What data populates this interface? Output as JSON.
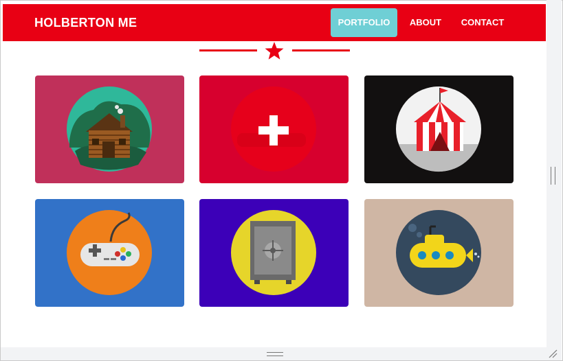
{
  "navbar": {
    "brand": "HOLBERTON ME",
    "links": [
      {
        "label": "PORTFOLIO",
        "active": true
      },
      {
        "label": "ABOUT",
        "active": false
      },
      {
        "label": "CONTACT",
        "active": false
      }
    ]
  },
  "colors": {
    "brand_red": "#e80014",
    "active_tab": "#6fcfd5"
  },
  "portfolio": [
    {
      "icon": "cabin-icon",
      "bg": "#c0305a"
    },
    {
      "icon": "plus-icon",
      "bg": "#d7002e"
    },
    {
      "icon": "circus-tent-icon",
      "bg": "#121010"
    },
    {
      "icon": "game-controller-icon",
      "bg": "#3272c8"
    },
    {
      "icon": "safe-icon",
      "bg": "#3c00b8"
    },
    {
      "icon": "submarine-icon",
      "bg": "#cfb6a4"
    }
  ]
}
